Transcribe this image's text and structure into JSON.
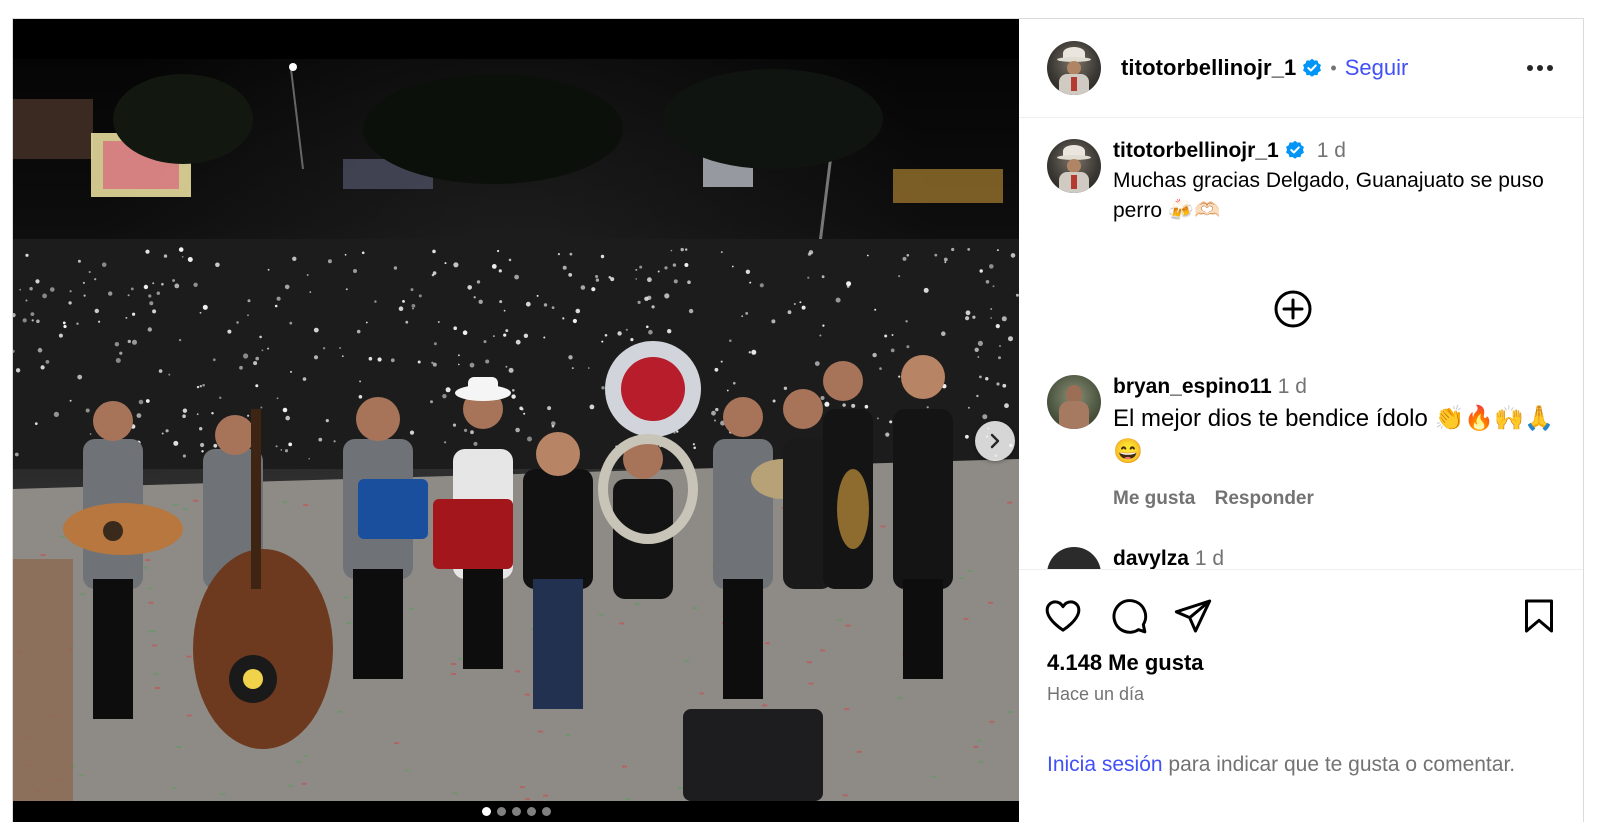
{
  "post": {
    "author": "titotorbellinojr_1",
    "follow_label": "Seguir",
    "separator": "•",
    "caption": {
      "username": "titotorbellinojr_1",
      "time": "1 d",
      "text": "Muchas gracias Delgado, Guanajuato se puso perro 🍻🫶🏻"
    },
    "comments": [
      {
        "username": "bryan_espino11",
        "time": "1 d",
        "text": "El mejor dios te bendice ídolo 👏🔥🙌🙏😄",
        "like_label": "Me gusta",
        "reply_label": "Responder"
      },
      {
        "username": "davylza",
        "time": "1 d"
      }
    ],
    "likes": "4.148 Me gusta",
    "posted_ago": "Hace un día",
    "login_prompt": {
      "link": "Inicia sesión",
      "rest": " para indicar que te gusta o comentar."
    }
  },
  "carousel": {
    "total": 5,
    "active_index": 0
  },
  "colors": {
    "link_blue": "#4150f7",
    "verified_blue": "#0095f6",
    "muted": "#737373"
  },
  "icons": [
    "verified-badge-icon",
    "more-options-icon",
    "load-more-comments-icon",
    "chevron-right-icon",
    "heart-icon",
    "comment-icon",
    "share-icon",
    "bookmark-icon"
  ]
}
